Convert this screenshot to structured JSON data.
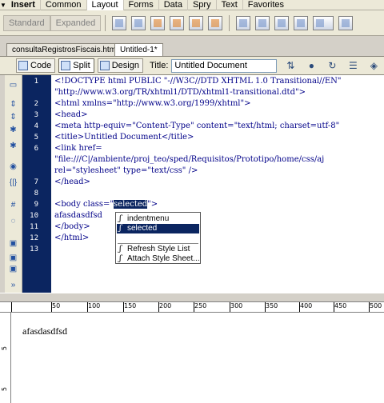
{
  "insert_bar": {
    "title": "Insert",
    "tabs": [
      "Common",
      "Layout",
      "Forms",
      "Data",
      "Spry",
      "Text",
      "Favorites"
    ],
    "active_tab": "Layout"
  },
  "layout_toolbar": {
    "standard_label": "Standard",
    "expanded_label": "Expanded"
  },
  "document_tabs": [
    "consultaRegistrosFiscais.html",
    "Untitled-1*"
  ],
  "doc_toolbar": {
    "code_label": "Code",
    "split_label": "Split",
    "design_label": "Design",
    "title_label": "Title:",
    "title_value": "Untitled Document"
  },
  "editor": {
    "line_numbers": [
      "1",
      "2",
      "3",
      "4",
      "5",
      "6",
      "7",
      "8",
      "9",
      "10",
      "11",
      "12",
      "13"
    ],
    "lines": [
      "<!DOCTYPE html PUBLIC \"-//W3C//DTD XHTML 1.0 Transitional//EN\"",
      "\"http://www.w3.org/TR/xhtml1/DTD/xhtml1-transitional.dtd\">",
      "<html xmlns=\"http://www.w3.org/1999/xhtml\">",
      "<head>",
      "<meta http-equiv=\"Content-Type\" content=\"text/html; charset=utf-8\"",
      "<title>Untitled Document</title>",
      "<link href=",
      "\"file:///C|/ambiente/proj_teo/sped/Requisitos/Prototipo/home/css/aj",
      "rel=\"stylesheet\" type=\"text/css\" />",
      "</head>",
      "",
      "<body class=\"",
      "selected",
      "\">",
      "afasdasdfsd",
      "</body>",
      "</html>"
    ]
  },
  "autocomplete": {
    "items": [
      "indentmenu",
      "selected"
    ],
    "selected_item": "selected",
    "actions": [
      "Refresh Style List",
      "Attach Style Sheet..."
    ]
  },
  "ruler": {
    "marks": [
      "50",
      "100",
      "150",
      "200",
      "250",
      "300",
      "350",
      "400",
      "450",
      "500"
    ],
    "v_marks": [
      "5",
      "5"
    ]
  },
  "design_view": {
    "text": "afasdasdfsd"
  }
}
